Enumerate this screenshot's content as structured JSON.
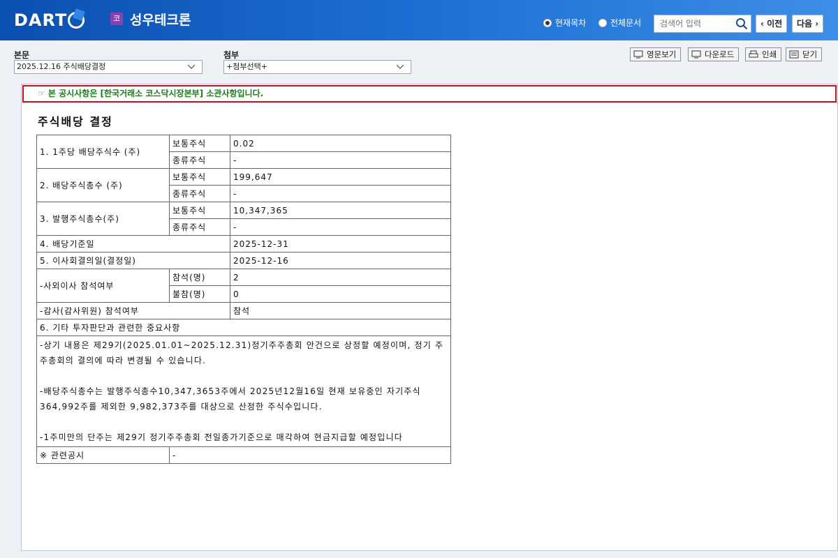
{
  "header": {
    "logo": "DART",
    "corp_badge": "코",
    "corp_name": "성우테크론",
    "radio_current": "현재목차",
    "radio_all": "전체문서",
    "search_placeholder": "검색어 입력",
    "prev_label": "이전",
    "next_label": "다음"
  },
  "toolbar": {
    "main_label": "본문",
    "main_select": "2025.12.16  주식배당결정",
    "attach_label": "첨부",
    "attach_select": "+첨부선택+",
    "btn_english": "영문보기",
    "btn_download": "다운로드",
    "btn_print": "인쇄",
    "btn_close": "닫기"
  },
  "document": {
    "notice": "☞ 본 공시사항은 [한국거래소 코스닥시장본부] 소관사항입니다.",
    "title": "주식배당 결정",
    "rows": {
      "r1_label": "1. 1주당 배당주식수 (주)",
      "r2_label": "2. 배당주식총수 (주)",
      "r3_label": "3. 발행주식총수(주)",
      "common": "보통주식",
      "preferred": "종류주식",
      "r1_common": "0.02",
      "r1_pref": "-",
      "r2_common": "199,647",
      "r2_pref": "-",
      "r3_common": "10,347,365",
      "r3_pref": "-",
      "r4_label": "4. 배당기준일",
      "r4_value": "2025-12-31",
      "r5_label": "5. 이사회결의일(결정일)",
      "r5_value": "2025-12-16",
      "outside_label": "-사외이사 참석여부",
      "attend": "참석(명)",
      "absent": "불참(명)",
      "attend_value": "2",
      "absent_value": "0",
      "auditor_label": "-감사(감사위원) 참석여부",
      "auditor_value": "참석",
      "r6_label": "6. 기타 투자판단과 관련한 중요사항",
      "r6_text": "-상기 내용은 제29기(2025.01.01~2025.12.31)정기주주총회 안건으로 상정할 예정이며, 정기 주주총회의 결의에 따라 변경될 수 있습니다.\n\n-배당주식총수는 발행주식총수10,347,3653주에서 2025년12월16일 현재 보유중인 자기주식 364,992주를 제외한 9,982,373주를 대상으로 산정한 주식수입니다.\n\n-1주미만의 단주는 제29기 정기주주총회 전일종가기준으로 매각하여 현금지급할 예정입니다",
      "related_label": "※ 관련공시",
      "related_value": "-"
    }
  }
}
